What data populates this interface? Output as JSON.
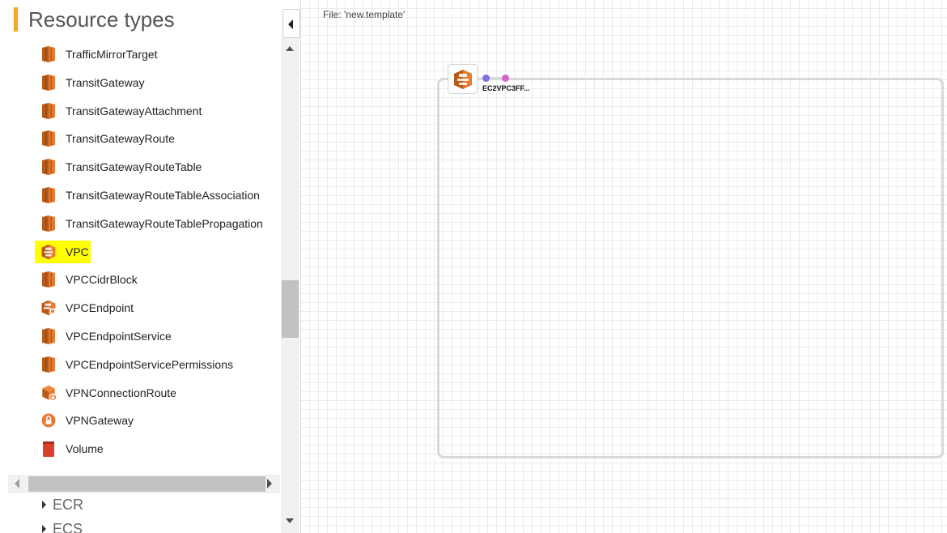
{
  "panel": {
    "title": "Resource types",
    "items": [
      {
        "label": "TrafficMirrorTarget",
        "icon": "ec2-bar-icon"
      },
      {
        "label": "TransitGateway",
        "icon": "ec2-bar-icon"
      },
      {
        "label": "TransitGatewayAttachment",
        "icon": "ec2-bar-icon"
      },
      {
        "label": "TransitGatewayRoute",
        "icon": "ec2-bar-icon"
      },
      {
        "label": "TransitGatewayRouteTable",
        "icon": "ec2-bar-icon"
      },
      {
        "label": "TransitGatewayRouteTableAssociation",
        "icon": "ec2-bar-icon"
      },
      {
        "label": "TransitGatewayRouteTablePropagation",
        "icon": "ec2-bar-icon"
      },
      {
        "label": "VPC",
        "icon": "vpc-icon",
        "highlighted": true
      },
      {
        "label": "VPCCidrBlock",
        "icon": "ec2-bar-icon"
      },
      {
        "label": "VPCEndpoint",
        "icon": "vpc-endpoint-icon"
      },
      {
        "label": "VPCEndpointService",
        "icon": "ec2-bar-icon"
      },
      {
        "label": "VPCEndpointServicePermissions",
        "icon": "ec2-bar-icon"
      },
      {
        "label": "VPNConnectionRoute",
        "icon": "vpn-connection-icon"
      },
      {
        "label": "VPNGateway",
        "icon": "vpn-gateway-icon"
      },
      {
        "label": "Volume",
        "icon": "volume-icon"
      }
    ],
    "groups": [
      {
        "label": "ECR"
      },
      {
        "label": "ECS"
      }
    ]
  },
  "canvas": {
    "file_label": "File: 'new.template'",
    "node": {
      "label": "EC2VPC3FF...",
      "icon": "vpc-icon"
    }
  },
  "colors": {
    "accent": "#f5a623",
    "aws_orange": "#e87a2f",
    "aws_orange_dark": "#b85a1a",
    "highlight": "#ffff00",
    "port_in": "#7b6ee8",
    "port_out": "#d266c8",
    "volume_red": "#d9412f"
  }
}
